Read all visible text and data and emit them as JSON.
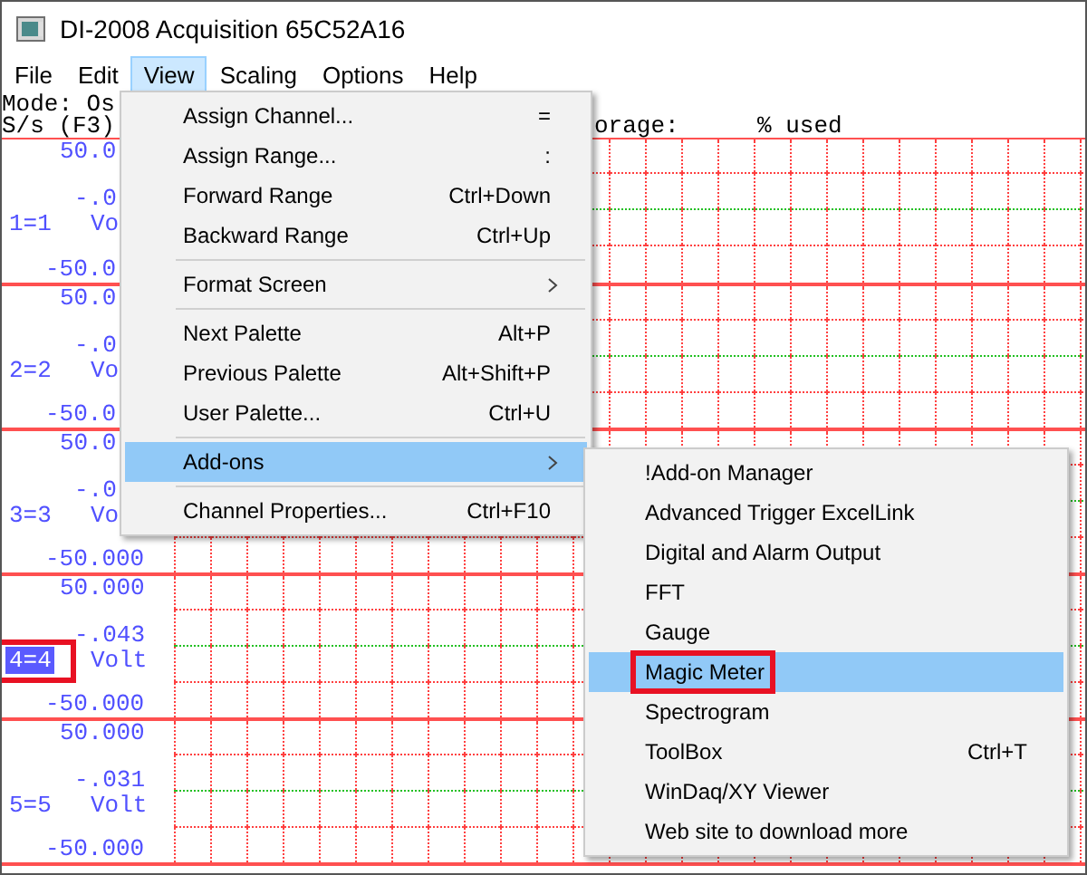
{
  "window": {
    "title": "DI-2008 Acquisition 65C52A16"
  },
  "menu_bar": [
    {
      "label": "File",
      "selected": false
    },
    {
      "label": "Edit",
      "selected": false
    },
    {
      "label": "View",
      "selected": true
    },
    {
      "label": "Scaling",
      "selected": false
    },
    {
      "label": "Options",
      "selected": false
    },
    {
      "label": "Help",
      "selected": false
    }
  ],
  "header": {
    "mode": "Mode: Os",
    "rate": "S/s (F3)",
    "storage_label": "orage:",
    "storage_value": "% used"
  },
  "channels": [
    {
      "max": "50.0",
      "mid": "-.0",
      "label": "1=1",
      "unit": "Vo",
      "min": "-50.0",
      "selected": false,
      "outlined": false
    },
    {
      "max": "50.0",
      "mid": "-.0",
      "label": "2=2",
      "unit": "Vo",
      "min": "-50.0",
      "selected": false,
      "outlined": false
    },
    {
      "max": "50.0",
      "mid": "-.0",
      "label": "3=3",
      "unit": "Vo",
      "min": "-50.000",
      "selected": false,
      "outlined": false
    },
    {
      "max": "50.000",
      "mid": "-.043",
      "label": "4=4",
      "unit": "Volt",
      "min": "-50.000",
      "selected": true,
      "outlined": true
    },
    {
      "max": "50.000",
      "mid": "-.031",
      "label": "5=5",
      "unit": "Volt",
      "min": "-50.000",
      "selected": false,
      "outlined": false
    }
  ],
  "view_menu": [
    {
      "kind": "item",
      "label": "Assign Channel...",
      "shortcut": "=",
      "submenu": false,
      "selected": false
    },
    {
      "kind": "item",
      "label": "Assign Range...",
      "shortcut": ":",
      "submenu": false,
      "selected": false
    },
    {
      "kind": "item",
      "label": "Forward Range",
      "shortcut": "Ctrl+Down",
      "submenu": false,
      "selected": false
    },
    {
      "kind": "item",
      "label": "Backward Range",
      "shortcut": "Ctrl+Up",
      "submenu": false,
      "selected": false
    },
    {
      "kind": "separator"
    },
    {
      "kind": "item",
      "label": "Format Screen",
      "submenu": true,
      "selected": false
    },
    {
      "kind": "separator"
    },
    {
      "kind": "item",
      "label": "Next Palette",
      "shortcut": "Alt+P",
      "submenu": false,
      "selected": false
    },
    {
      "kind": "item",
      "label": "Previous Palette",
      "shortcut": "Alt+Shift+P",
      "submenu": false,
      "selected": false
    },
    {
      "kind": "item",
      "label": "User Palette...",
      "shortcut": "Ctrl+U",
      "submenu": false,
      "selected": false
    },
    {
      "kind": "separator"
    },
    {
      "kind": "item",
      "label": "Add-ons",
      "submenu": true,
      "selected": true
    },
    {
      "kind": "separator"
    },
    {
      "kind": "item",
      "label": "Channel Properties...",
      "shortcut": "Ctrl+F10",
      "submenu": false,
      "selected": false
    }
  ],
  "addons_menu": [
    {
      "label": "!Add-on Manager",
      "selected": false,
      "outlined": false
    },
    {
      "label": "Advanced Trigger ExcelLink",
      "selected": false,
      "outlined": false
    },
    {
      "label": "Digital and Alarm Output",
      "selected": false,
      "outlined": false
    },
    {
      "label": "FFT",
      "selected": false,
      "outlined": false
    },
    {
      "label": "Gauge",
      "selected": false,
      "outlined": false
    },
    {
      "label": "Magic Meter",
      "selected": true,
      "outlined": true
    },
    {
      "label": "Spectrogram",
      "selected": false,
      "outlined": false
    },
    {
      "label": "ToolBox",
      "shortcut": "Ctrl+T",
      "selected": false,
      "outlined": false
    },
    {
      "label": "WinDaq/XY Viewer",
      "selected": false,
      "outlined": false
    },
    {
      "label": "Web site to download more",
      "selected": false,
      "outlined": false
    }
  ]
}
